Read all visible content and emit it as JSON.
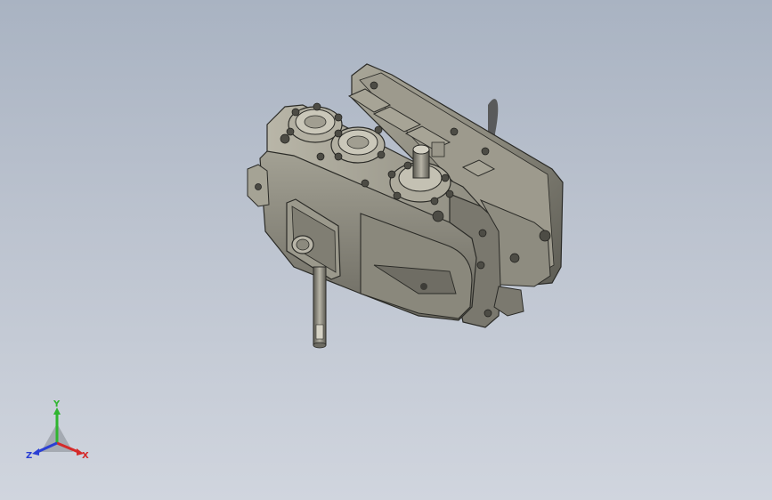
{
  "viewport": {
    "background_top": "#a9b3c2",
    "background_bottom": "#d0d5de"
  },
  "model": {
    "body_color": "#8d8b7f",
    "edge_color": "#2b2b27"
  },
  "triad": {
    "x_label": "X",
    "y_label": "Y",
    "z_label": "Z",
    "x_color": "#d42a2a",
    "y_color": "#2fb52f",
    "z_color": "#2a3fd4"
  }
}
